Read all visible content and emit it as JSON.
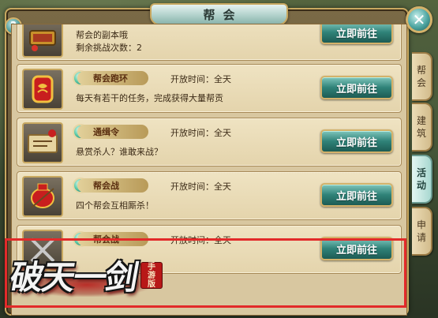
{
  "window": {
    "title": "帮会",
    "help_label": "?",
    "close_label": "✕"
  },
  "tabs": [
    {
      "label_chars": [
        "帮",
        "会"
      ],
      "active": false
    },
    {
      "label_chars": [
        "建",
        "筑"
      ],
      "active": false
    },
    {
      "label_chars": [
        "活",
        "动"
      ],
      "active": true
    },
    {
      "label_chars": [
        "申",
        "请"
      ],
      "active": false
    }
  ],
  "activities": [
    {
      "icon": "scroll-box-icon",
      "name": "",
      "open_time": "",
      "description": "帮会的副本哦",
      "extra": "剩余挑战次数：2",
      "button": "立即前往"
    },
    {
      "icon": "red-medal-icon",
      "name": "帮会跑环",
      "open_time": "开放时间：全天",
      "description": "每天有若干的任务，完成获得大量帮贡",
      "button": "立即前往"
    },
    {
      "icon": "wanted-scroll-icon",
      "name": "通缉令",
      "open_time": "开放时间：全天",
      "description": "悬赏杀人？谁敢来战？",
      "button": "立即前往"
    },
    {
      "icon": "war-drum-icon",
      "name": "帮会战",
      "open_time": "开放时间：全天",
      "description": "四个帮会互相厮杀！",
      "button": "立即前往"
    },
    {
      "icon": "guild-battle-icon",
      "name": "帮会战",
      "open_time": "开放时间：全天",
      "description": "",
      "button": "立即前往"
    }
  ],
  "logo": {
    "text": "破天一剑",
    "seal_chars": [
      "手",
      "游",
      "版"
    ]
  },
  "colors": {
    "button_teal": "#2f8278",
    "highlight_red": "#e22a2a",
    "frame_gold": "#c8a860"
  }
}
